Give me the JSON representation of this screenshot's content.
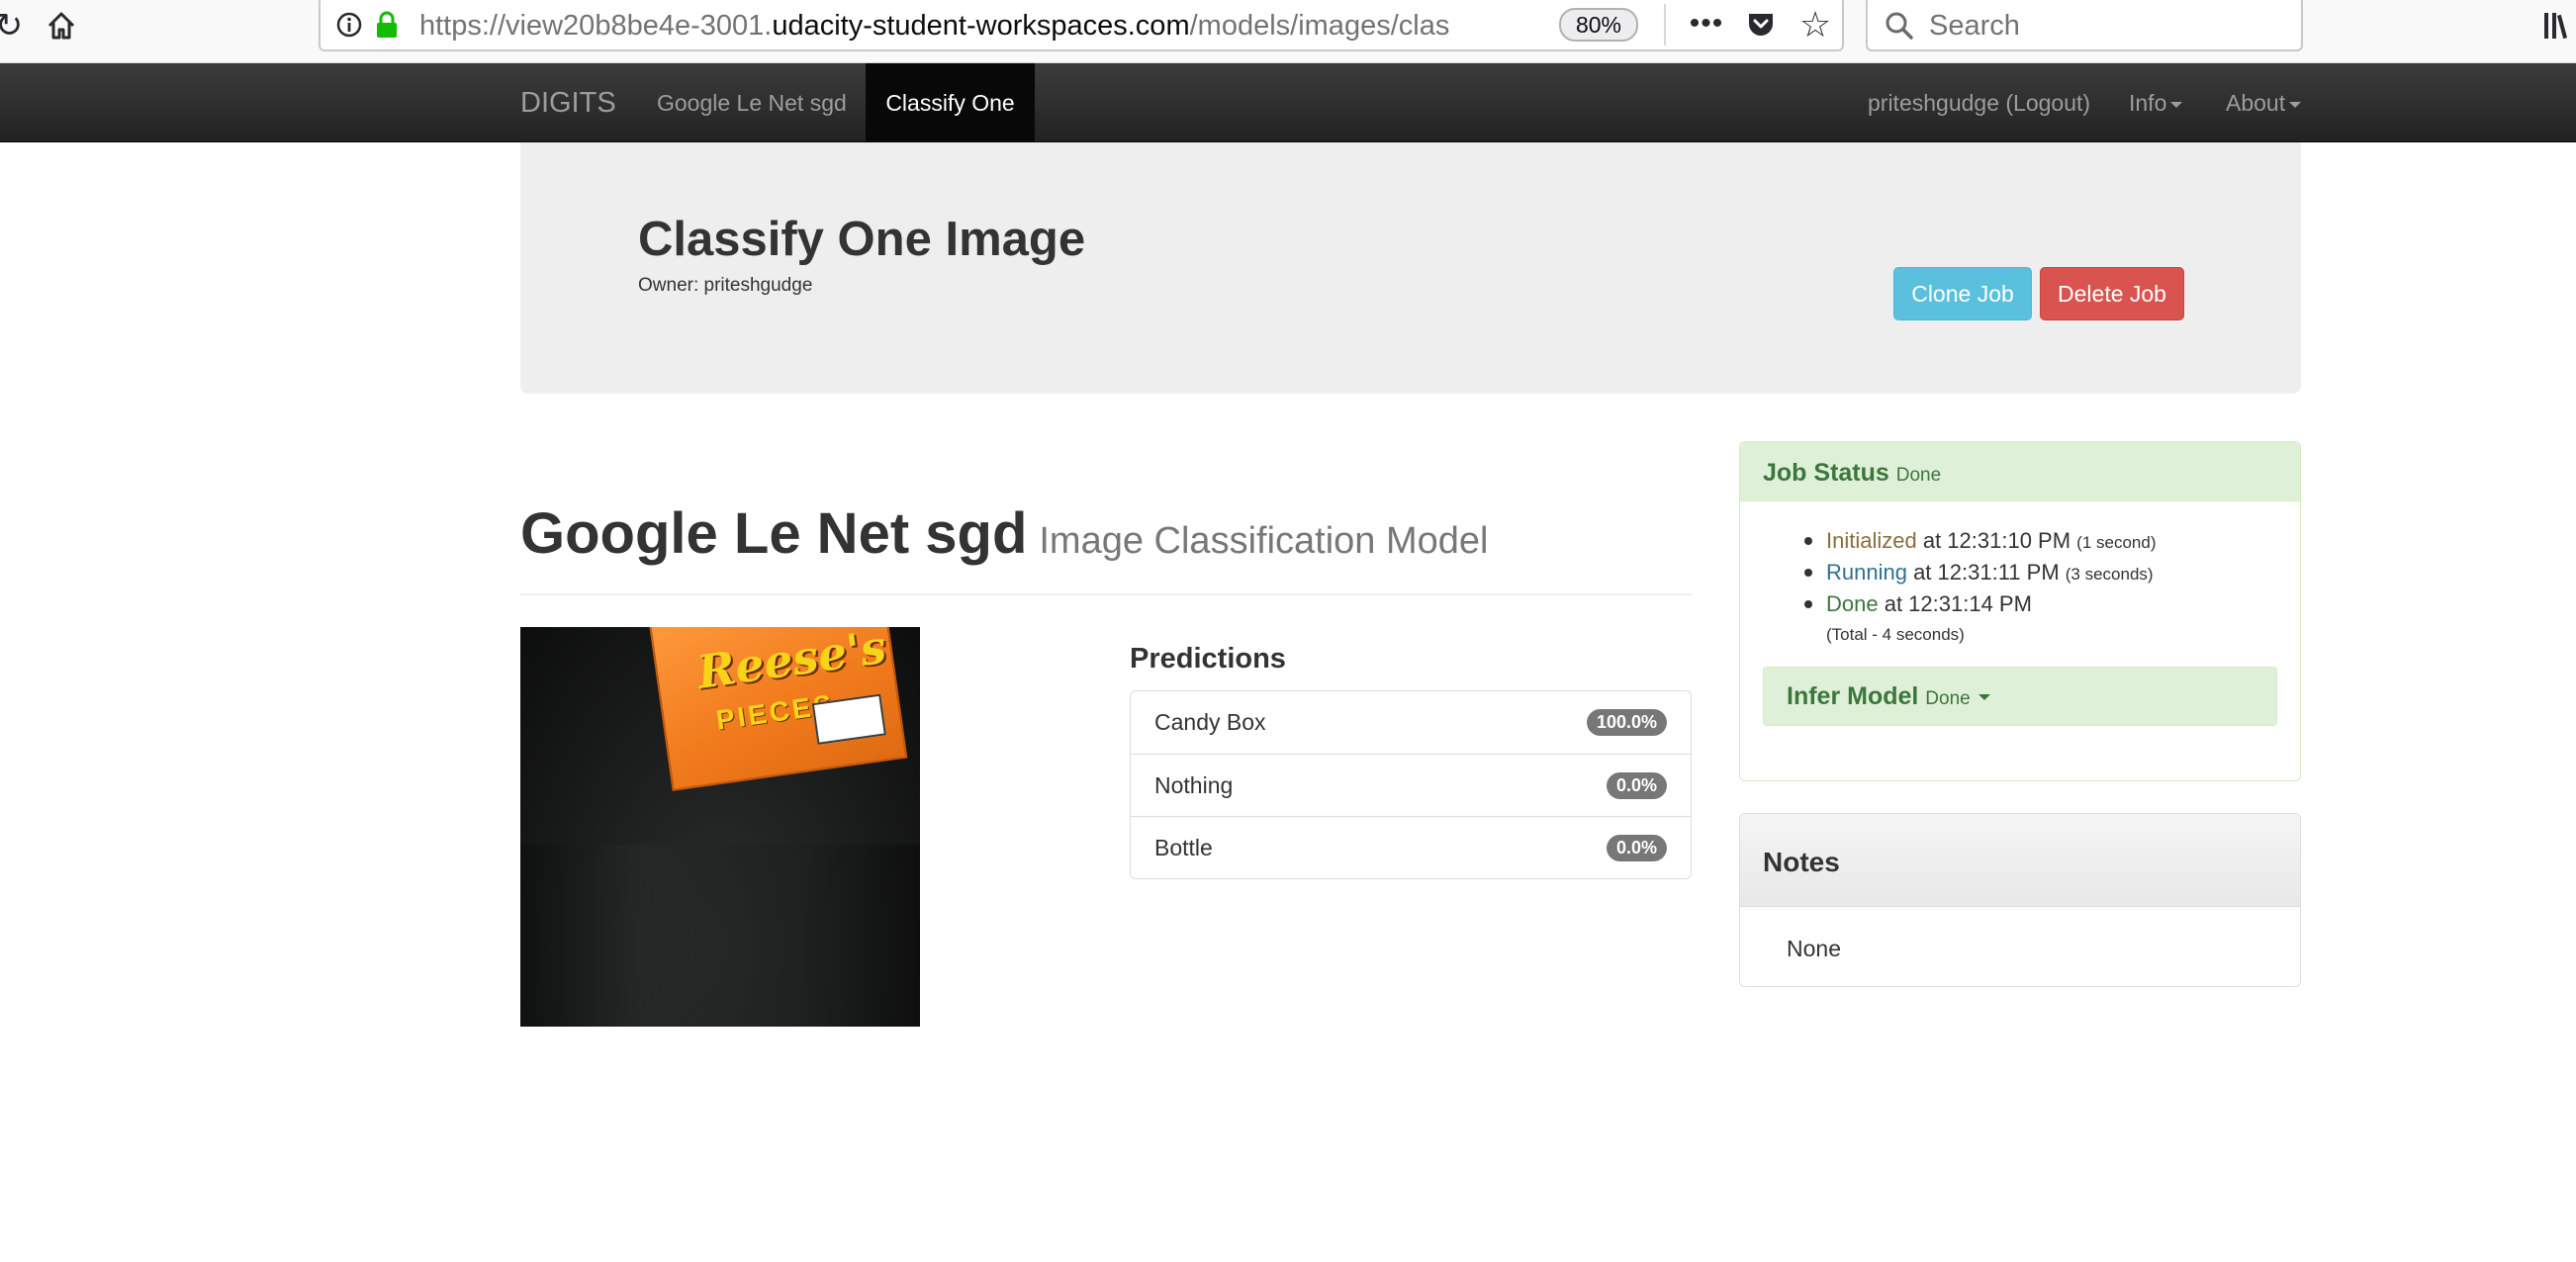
{
  "browser": {
    "url_prefix": "https://view20b8be4e-3001.",
    "url_host": "udacity-student-workspaces.com",
    "url_path": "/models/images/clas",
    "zoom": "80%",
    "search_placeholder": "Search",
    "icons": [
      "reload-icon",
      "home-icon",
      "info-icon",
      "lock-icon",
      "more-icon",
      "pocket-icon",
      "bookmark-star-icon",
      "search-icon",
      "library-icon"
    ]
  },
  "navbar": {
    "brand": "DIGITS",
    "model_link": "Google Le Net sgd",
    "active_link": "Classify One",
    "user_link": "priteshgudge (Logout)",
    "info_menu": "Info",
    "about_menu": "About"
  },
  "header": {
    "title": "Classify One Image",
    "owner": "Owner: priteshgudge",
    "clone_button": "Clone Job",
    "delete_button": "Delete Job"
  },
  "model": {
    "name": "Google Le Net sgd",
    "subtitle": "Image Classification Model"
  },
  "image": {
    "box_brand": "Reese's",
    "box_sub": "PIECES"
  },
  "predictions": {
    "heading": "Predictions",
    "items": [
      {
        "label": "Candy Box",
        "value": "100.0%"
      },
      {
        "label": "Nothing",
        "value": "0.0%"
      },
      {
        "label": "Bottle",
        "value": "0.0%"
      }
    ]
  },
  "job_status": {
    "title": "Job Status",
    "state": "Done",
    "entries": [
      {
        "status": "Initialized",
        "at": " at 12:31:10 PM ",
        "duration": "(1 second)"
      },
      {
        "status": "Running",
        "at": " at 12:31:11 PM ",
        "duration": "(3 seconds)"
      },
      {
        "status": "Done",
        "at": " at 12:31:14 PM",
        "duration": ""
      }
    ],
    "total": "(Total - 4 seconds)",
    "infer_title": "Infer Model",
    "infer_state": "Done"
  },
  "notes": {
    "title": "Notes",
    "body": "None"
  },
  "colors": {
    "navbar": "#222222",
    "clone_button": "#5bc0de",
    "delete_button": "#d9534f",
    "success_bg": "#dff0d8",
    "success_text": "#3c763d",
    "badge": "#777777"
  }
}
